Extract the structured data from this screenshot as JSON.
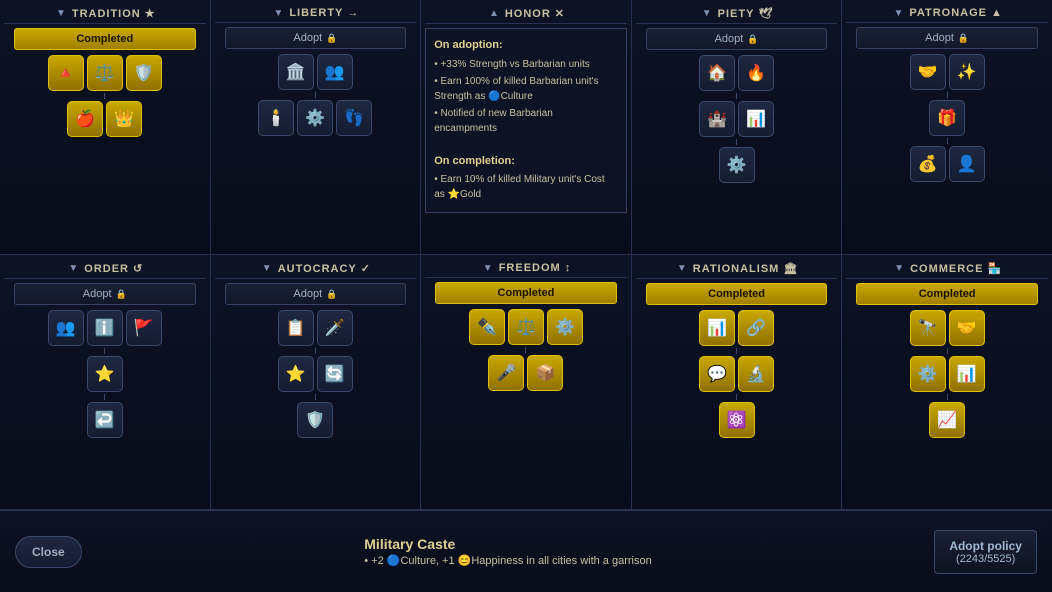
{
  "panels_top": [
    {
      "id": "tradition",
      "name": "TRADITION",
      "name_icon": "★",
      "status": "completed",
      "status_label": "Completed",
      "icons_row1": [
        "🔺",
        "⚖️",
        "🛡️"
      ],
      "icons_row2": [
        "🍎",
        "👑"
      ],
      "adopt_label": "Adopt",
      "is_tooltip": false
    },
    {
      "id": "liberty",
      "name": "LIBERTY",
      "name_icon": "→",
      "status": "adopt",
      "status_label": "Adopt",
      "icons_row1": [
        "🏛️",
        "👥"
      ],
      "icons_row2": [
        "🕯️",
        "⚙️",
        "👣"
      ],
      "adopt_label": "Adopt",
      "is_tooltip": false
    },
    {
      "id": "honor",
      "name": "HONOR",
      "name_icon": "✕",
      "status": "tooltip",
      "is_tooltip": true,
      "tooltip_adoption_title": "On adoption:",
      "tooltip_adoption_bullets": [
        "• +33% Strength vs Barbarian units",
        "• Earn 100% of killed Barbarian unit's Strength as 🔵Culture",
        "• Notified of new Barbarian encampments"
      ],
      "tooltip_completion_title": "On completion:",
      "tooltip_completion_bullets": [
        "• Earn 10% of killed Military unit's Cost as ⭐Gold"
      ]
    },
    {
      "id": "piety",
      "name": "PIETY",
      "name_icon": "🕊️",
      "status": "adopt",
      "status_label": "Adopt",
      "icons_row1": [
        "🏠",
        "🔥"
      ],
      "icons_row2": [
        "🏰",
        "📊"
      ],
      "icons_row3": [
        "⚙️"
      ],
      "adopt_label": "Adopt",
      "is_tooltip": false
    },
    {
      "id": "patronage",
      "name": "PATRONAGE",
      "name_icon": "▲",
      "status": "adopt",
      "status_label": "Adopt",
      "icons_row1": [
        "🤝",
        "✨"
      ],
      "icons_row2": [
        "🎁"
      ],
      "icons_row3": [
        "💰",
        "👤"
      ],
      "adopt_label": "Adopt",
      "is_tooltip": false
    }
  ],
  "panels_bottom": [
    {
      "id": "order",
      "name": "ORDER",
      "name_icon": "↺",
      "status": "adopt",
      "status_label": "Adopt",
      "icons_row1": [
        "👥",
        "ℹ️",
        "🚩"
      ],
      "icons_row2": [
        "⭐"
      ],
      "icons_row3": [
        "↩️"
      ],
      "adopt_label": "Adopt"
    },
    {
      "id": "autocracy",
      "name": "AUTOCRACY",
      "name_icon": "✓",
      "status": "adopt",
      "status_label": "Adopt",
      "icons_row1": [
        "📋",
        "🗡️"
      ],
      "icons_row2": [
        "⭐",
        "🔄"
      ],
      "icons_row3": [
        "🛡️"
      ],
      "adopt_label": "Adopt"
    },
    {
      "id": "freedom",
      "name": "FREEDOM",
      "name_icon": "↕️",
      "status": "completed",
      "status_label": "Completed",
      "icons_row1": [
        "✒️",
        "⚖️",
        "⚙️"
      ],
      "icons_row2": [
        "🎤",
        "📦"
      ]
    },
    {
      "id": "rationalism",
      "name": "RATIONALISM",
      "name_icon": "🏛️",
      "status": "completed",
      "status_label": "Completed",
      "icons_row1": [
        "📊",
        "🔗"
      ],
      "icons_row2": [
        "💬",
        "🔬"
      ],
      "icons_row3": [
        "⚛️"
      ]
    },
    {
      "id": "commerce",
      "name": "COMMERCE",
      "name_icon": "🏪",
      "status": "completed",
      "status_label": "Completed",
      "icons_row1": [
        "🔭",
        "🤝"
      ],
      "icons_row2": [
        "⚙️",
        "📊"
      ],
      "icons_row3": [
        "📈"
      ]
    }
  ],
  "bottom_bar": {
    "close_label": "Close",
    "policy_name": "Military Caste",
    "policy_desc": "• +2 🔵Culture, +1 😊Happiness in all cities with a garrison",
    "adopt_btn_line1": "Adopt policy",
    "adopt_btn_line2": "(2243/5525)"
  }
}
